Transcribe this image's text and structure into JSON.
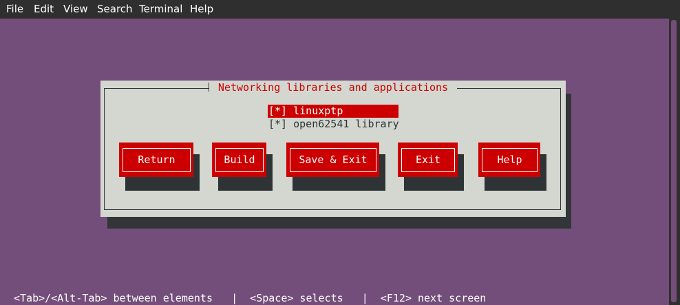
{
  "menubar": {
    "items": [
      "File",
      "Edit",
      "View",
      "Search",
      "Terminal",
      "Help"
    ]
  },
  "dialog": {
    "title": "Networking libraries and applications",
    "checklist": [
      {
        "text": "[*] linuxptp",
        "selected": true
      },
      {
        "text": "[*] open62541 library",
        "selected": false
      }
    ],
    "buttons": [
      "Return",
      "Build",
      "Save & Exit",
      "Exit",
      "Help"
    ]
  },
  "status_line": "<Tab>/<Alt-Tab> between elements   |  <Space> selects   |  <F12> next screen",
  "colors": {
    "terminal_bg": "#744e7a",
    "menubar_bg": "#2f2f2f",
    "dialog_bg": "#d3d7cf",
    "accent_red": "#cc0000",
    "shadow": "#2e3436"
  }
}
